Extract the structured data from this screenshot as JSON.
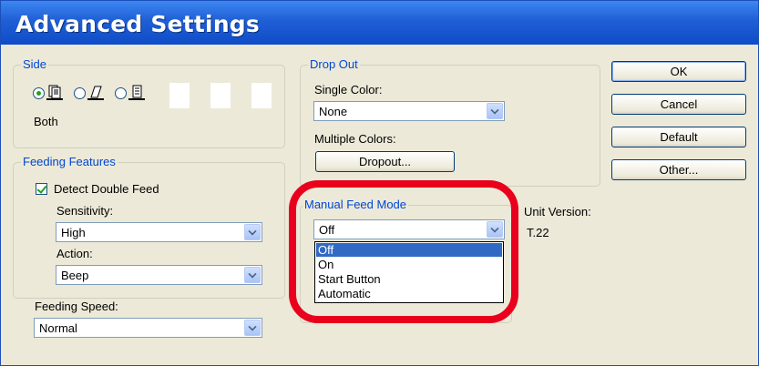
{
  "window": {
    "title": "Advanced Settings"
  },
  "side": {
    "legend": "Side",
    "options": [
      {
        "name": "both",
        "selected": true
      },
      {
        "name": "front",
        "selected": false
      },
      {
        "name": "back",
        "selected": false
      }
    ],
    "selected_label": "Both"
  },
  "feeding_features": {
    "legend": "Feeding Features",
    "detect_double_feed": {
      "label": "Detect Double Feed",
      "checked": true
    },
    "sensitivity": {
      "label": "Sensitivity:",
      "value": "High"
    },
    "action": {
      "label": "Action:",
      "value": "Beep"
    }
  },
  "feeding_speed": {
    "label": "Feeding Speed:",
    "value": "Normal"
  },
  "drop_out": {
    "legend": "Drop Out",
    "single_color": {
      "label": "Single Color:",
      "value": "None"
    },
    "multiple_colors": {
      "label": "Multiple Colors:"
    },
    "dropout_button": "Dropout..."
  },
  "manual_feed_mode": {
    "legend": "Manual Feed Mode",
    "value": "Off",
    "options": [
      "Off",
      "On",
      "Start Button",
      "Automatic"
    ],
    "highlighted_index": 0,
    "highlight_color": "#e8001c"
  },
  "unit_version": {
    "label": "Unit Version:",
    "value": "T.22"
  },
  "buttons": {
    "ok": "OK",
    "cancel": "Cancel",
    "default": "Default",
    "other": "Other..."
  },
  "colors": {
    "title_bar": "#1f5fd6",
    "legend_text": "#0046d5",
    "selection": "#316ac5"
  }
}
